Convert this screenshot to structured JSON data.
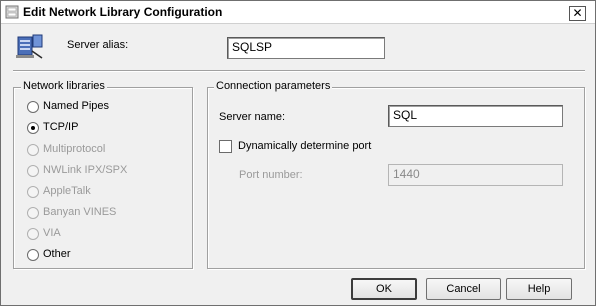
{
  "window": {
    "title": "Edit Network Library Configuration",
    "close_glyph": "✕"
  },
  "alias": {
    "label": "Server alias:",
    "value": "SQLSP",
    "icon": "server-icon"
  },
  "network_libraries": {
    "title": "Network libraries",
    "options": [
      {
        "label": "Named Pipes",
        "checked": false,
        "enabled": true
      },
      {
        "label": "TCP/IP",
        "checked": true,
        "enabled": true
      },
      {
        "label": "Multiprotocol",
        "checked": false,
        "enabled": false
      },
      {
        "label": "NWLink IPX/SPX",
        "checked": false,
        "enabled": false
      },
      {
        "label": "AppleTalk",
        "checked": false,
        "enabled": false
      },
      {
        "label": "Banyan VINES",
        "checked": false,
        "enabled": false
      },
      {
        "label": "VIA",
        "checked": false,
        "enabled": false
      },
      {
        "label": "Other",
        "checked": false,
        "enabled": true
      }
    ]
  },
  "connection": {
    "title": "Connection parameters",
    "server_name_label": "Server name:",
    "server_name_value": "SQL",
    "dynamic_port_label": "Dynamically determine port",
    "dynamic_port_checked": false,
    "port_label": "Port number:",
    "port_value": "1440"
  },
  "buttons": {
    "ok": "OK",
    "cancel": "Cancel",
    "help": "Help"
  }
}
